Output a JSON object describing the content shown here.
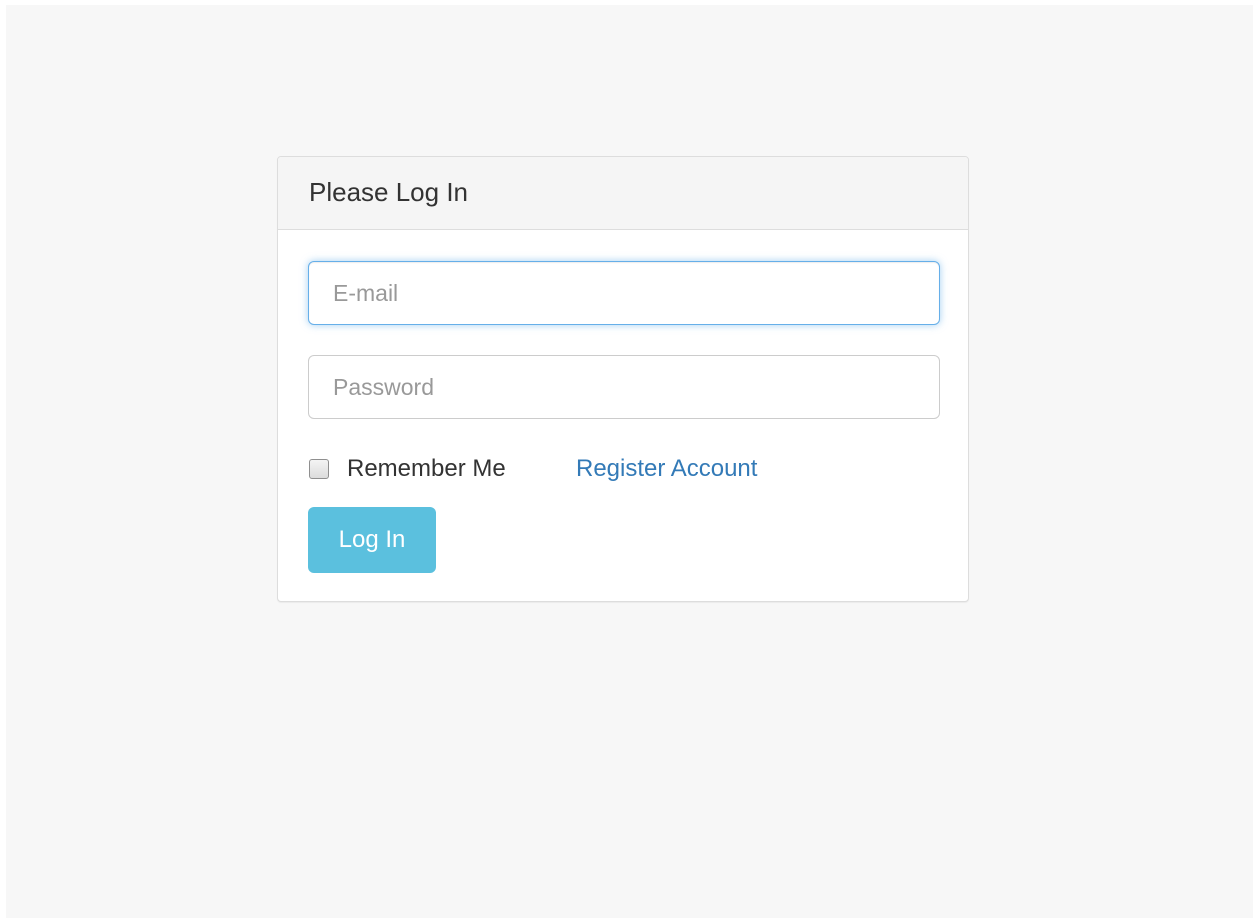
{
  "login_panel": {
    "title": "Please Log In",
    "email": {
      "value": "",
      "placeholder": "E-mail"
    },
    "password": {
      "value": "",
      "placeholder": "Password"
    },
    "remember_me": {
      "label": "Remember Me",
      "checked": false
    },
    "register_link": "Register Account",
    "submit_label": "Log In"
  },
  "colors": {
    "page_background": "#f7f7f7",
    "panel_heading": "#f5f5f5",
    "focus_ring": "#66afe9",
    "link": "#337ab7",
    "button": "#5bc0de"
  }
}
